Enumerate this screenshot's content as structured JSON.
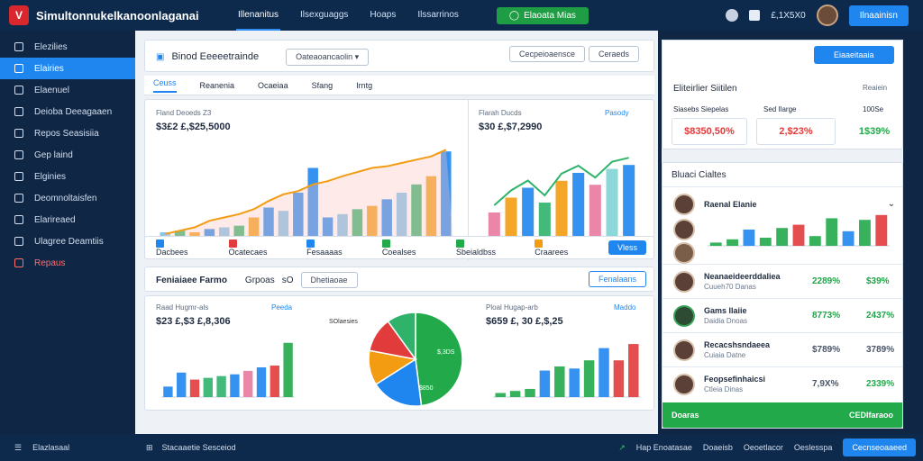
{
  "app": {
    "title": "Simultonnukelkanoonlaganai",
    "logo_letter": "V"
  },
  "topnav": [
    "Illenanitus",
    "Ilsexguaggs",
    "Hoaps",
    "Ilssarrinos"
  ],
  "top_status_button": "Elaoata Mias",
  "top_right": {
    "balance": "£,1X5X0",
    "cta": "Ilnaainisn"
  },
  "sidebar": [
    {
      "label": "Elezilies",
      "icon": "pen-icon",
      "active": false
    },
    {
      "label": "Elairies",
      "icon": "grid-icon",
      "active": true
    },
    {
      "label": "Elaenuel",
      "icon": "info-icon",
      "active": false
    },
    {
      "label": "Deioba Deeagaaen",
      "icon": "doc-icon",
      "active": false
    },
    {
      "label": "Repos Seasisiia",
      "icon": "table-icon",
      "active": false
    },
    {
      "label": "Gep laind",
      "icon": "box-icon",
      "active": false
    },
    {
      "label": "Elginies",
      "icon": "search-icon",
      "active": false
    },
    {
      "label": "Deomnoltaisfen",
      "icon": "list-icon",
      "active": false
    },
    {
      "label": "Elarireaed",
      "icon": "clock-icon",
      "active": false
    },
    {
      "label": "Ulagree Deamtiis",
      "icon": "globe-icon",
      "active": false
    },
    {
      "label": "Repaus",
      "icon": "puzzle-icon",
      "active": false,
      "danger": true
    }
  ],
  "main": {
    "section_title": "Binod Eeeeetrainde",
    "dropdown": "Oateaoancaolin",
    "header_buttons": [
      "Cecpeioaensce",
      "Ceraeds"
    ],
    "tabs": [
      "Ceuss",
      "Reanenia",
      "Ocaeiaa",
      "Sfang",
      "Irntg"
    ],
    "chart1": {
      "title": "Fland Deoeds Z3",
      "value": "$3£2 £,$25,5000"
    },
    "chart2": {
      "title": "Flarah Ducds",
      "value": "$30 £,$7,2990",
      "link": "Pasody"
    },
    "legend": [
      {
        "label": "Dacbees",
        "color": "#1f86ef"
      },
      {
        "label": "Ocatecaes",
        "color": "#e23b3b"
      },
      {
        "label": "Fesaaaas",
        "color": "#1f86ef"
      },
      {
        "label": "Coealses",
        "color": "#22a94a"
      },
      {
        "label": "Sbeialdbss",
        "color": "#22a94a"
      },
      {
        "label": "Craarees",
        "color": "#f39c12"
      }
    ],
    "legend_button": "Vless",
    "performance_title": "Feniaiaee Farmo",
    "perf_chips": [
      "Grpoas",
      "sO",
      "Dhetiaoae"
    ],
    "perf_button": "Fenalaans",
    "chart3": {
      "title": "Raad Hugmr-als",
      "value": "$23 £,$3 £,8,306",
      "link": "Peeda"
    },
    "chart4": {
      "title": "Ploal Hugap-arb",
      "value": "$659 £, 30 £,$,25",
      "link": "Maddo"
    },
    "pie_labels": [
      "SOlaesies",
      "$,3DS",
      "LS(A",
      "$850"
    ]
  },
  "right": {
    "cta": "Eiaaeitaaia",
    "card_title": "Eliteirlier Siitilen",
    "card_tag": "Reaiein",
    "col_labels": [
      "Siasebs Siepelas",
      "Sed Ilarge",
      "100Se"
    ],
    "stats": [
      {
        "value": "$8350,50%",
        "color": "#e23b3b"
      },
      {
        "value": "2,$23%",
        "color": "#e23b3b"
      },
      {
        "value": "1$39%",
        "color": "#22a94a"
      }
    ],
    "list_title": "Bluaci Cialtes",
    "people": [
      {
        "name": "Raenal Elanie",
        "sub": "",
        "v1": "",
        "v2": ""
      },
      {
        "name": "Neanaeideerddaliea",
        "sub": "Cuueh70 Danas",
        "v1": "2289%",
        "v2": "$39%"
      },
      {
        "name": "Gams Ilaiie",
        "sub": "Daidia Dnoas",
        "v1": "8773%",
        "v2": "2437%"
      },
      {
        "name": "Recacshsndaeea",
        "sub": "Cuiaia Datne",
        "v1": "$789%",
        "v2": "3789%"
      },
      {
        "name": "Feopsefinhaicsi",
        "sub": "Ctleia Dinas",
        "v1": "7,9X%",
        "v2": "2339%"
      }
    ],
    "footer_left": "Doaras",
    "footer_right": "CEDIfaraoo"
  },
  "bottom": {
    "left": "Elazlasaal",
    "mid": "Stacaaetie Sesceiod",
    "items": [
      "Hap Enoatasae",
      "Doaeisb",
      "Oeoetlacor",
      "Oeslesspa"
    ],
    "cta": "Cecnseoaaeed"
  },
  "chart_data": [
    {
      "type": "bar",
      "title": "Fland Deoeds Z3",
      "categories": [
        "1",
        "2",
        "3",
        "4",
        "5",
        "6",
        "7",
        "8",
        "9",
        "10",
        "11",
        "12",
        "13",
        "14",
        "15",
        "16",
        "17",
        "18",
        "19",
        "20"
      ],
      "values": [
        12,
        14,
        12,
        16,
        18,
        20,
        30,
        42,
        38,
        60,
        90,
        30,
        34,
        40,
        44,
        52,
        60,
        70,
        80,
        110
      ],
      "series": [
        {
          "values": [
            10,
            14,
            18,
            26,
            30,
            34,
            40,
            50,
            58,
            62,
            70,
            74,
            80,
            85,
            90,
            92,
            96,
            100,
            104,
            112
          ]
        }
      ],
      "ylim": [
        0,
        120
      ]
    },
    {
      "type": "bar",
      "title": "Flarah Ducds",
      "categories": [
        "1",
        "2",
        "3",
        "4",
        "5",
        "6",
        "7",
        "8",
        "9"
      ],
      "values": [
        30,
        45,
        55,
        40,
        62,
        70,
        58,
        74,
        78
      ],
      "ylim": [
        0,
        100
      ]
    },
    {
      "type": "bar",
      "title": "Raad Hugmr-als",
      "categories": [
        "1",
        "2",
        "3",
        "4",
        "5",
        "6",
        "7",
        "8",
        "9",
        "10"
      ],
      "values": [
        12,
        28,
        20,
        22,
        24,
        26,
        30,
        34,
        36,
        62
      ],
      "ylim": [
        0,
        70
      ]
    },
    {
      "type": "pie",
      "categories": [
        "A",
        "B",
        "C",
        "D",
        "E"
      ],
      "values": [
        48,
        18,
        12,
        12,
        10
      ]
    },
    {
      "type": "bar",
      "title": "Ploal Hugap-arb",
      "categories": [
        "1",
        "2",
        "3",
        "4",
        "5",
        "6",
        "7",
        "8",
        "9",
        "10"
      ],
      "values": [
        4,
        6,
        8,
        26,
        30,
        28,
        36,
        48,
        36,
        52
      ],
      "ylim": [
        0,
        60
      ]
    },
    {
      "type": "bar",
      "categories": [
        "1",
        "2",
        "3",
        "4",
        "5",
        "6",
        "7",
        "8",
        "9",
        "10",
        "11"
      ],
      "values": [
        4,
        8,
        20,
        10,
        22,
        26,
        12,
        34,
        18,
        32,
        38
      ],
      "ylim": [
        0,
        40
      ]
    }
  ]
}
